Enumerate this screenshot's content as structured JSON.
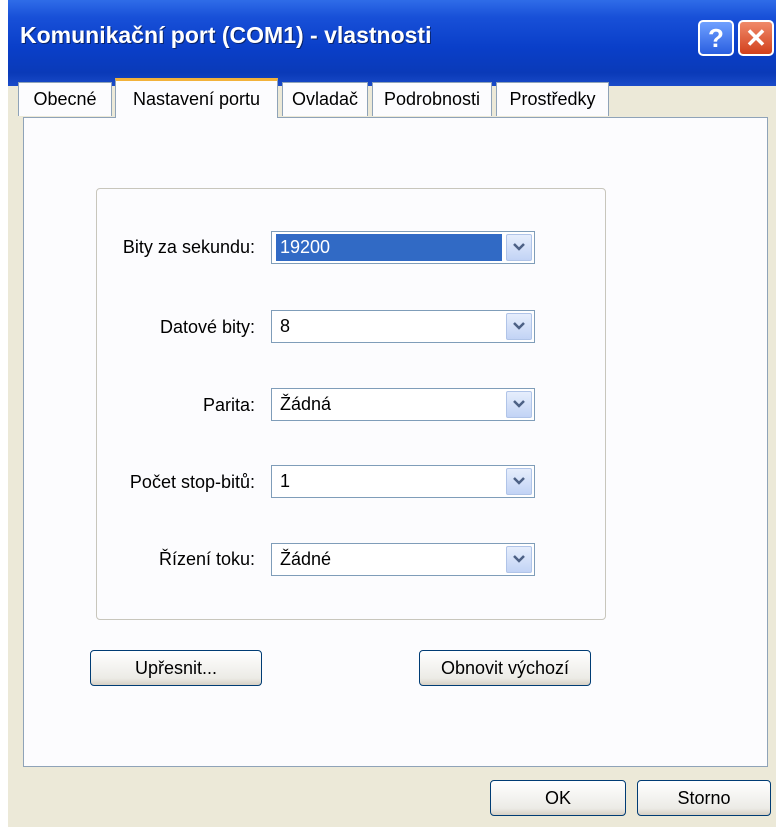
{
  "window": {
    "title": "Komunikační port (COM1)  - vlastnosti",
    "help_glyph": "?",
    "close_glyph": "✕"
  },
  "tabs": [
    {
      "label": "Obecné",
      "active": false
    },
    {
      "label": "Nastavení portu",
      "active": true
    },
    {
      "label": "Ovladač",
      "active": false
    },
    {
      "label": "Podrobnosti",
      "active": false
    },
    {
      "label": "Prostředky",
      "active": false
    }
  ],
  "port_settings": {
    "bits_per_second": {
      "label": "Bity za sekundu:",
      "value": "19200"
    },
    "data_bits": {
      "label": "Datové bity:",
      "value": "8"
    },
    "parity": {
      "label": "Parita:",
      "value": "Žádná"
    },
    "stop_bits": {
      "label": "Počet stop-bitů:",
      "value": "1"
    },
    "flow_control": {
      "label": "Řízení toku:",
      "value": "Žádné"
    }
  },
  "buttons": {
    "advanced": "Upřesnit...",
    "restore_defaults": "Obnovit výchozí",
    "ok": "OK",
    "cancel": "Storno"
  },
  "colors": {
    "titlebar": "#0A3FC9",
    "selection": "#316AC5",
    "dialog_bg": "#ECE9D8",
    "active_tab_accent": "#F2B23A"
  },
  "icons": {
    "dropdown": "chevron-down-icon",
    "help": "help-icon",
    "close": "close-icon"
  }
}
